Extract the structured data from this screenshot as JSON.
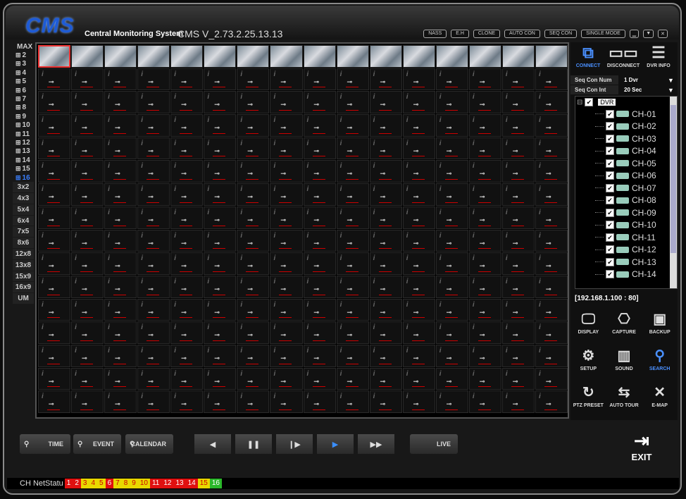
{
  "window": {
    "logo": "CMS",
    "title": "Central Monitoring System",
    "version": "CMS V_2.73.2.25.13.13",
    "buttons": [
      "NASS",
      "E.H",
      "CLONE",
      "AUTO CON",
      "SEQ CON",
      "SINGLE MODE"
    ],
    "window_controls": [
      "minimize-icon",
      "menu-icon",
      "close-icon"
    ]
  },
  "layout_menu": {
    "numbered": [
      "MAX",
      "2",
      "3",
      "4",
      "5",
      "6",
      "7",
      "8",
      "9",
      "10",
      "11",
      "12",
      "13",
      "14",
      "15",
      "16"
    ],
    "active": "16",
    "presets": [
      "3x2",
      "4x3",
      "5x4",
      "6x4",
      "7x5",
      "8x6",
      "12x8",
      "13x8",
      "15x9",
      "16x9",
      "UM"
    ]
  },
  "video_grid": {
    "columns": 16,
    "rows": 16,
    "live_rows": 1,
    "selected_cell": 0,
    "placeholder_icon": "disconnected-plug-icon",
    "placeholder_logo": "i"
  },
  "connection": {
    "buttons": [
      {
        "label": "CONNECT",
        "icon": "connect-icon",
        "active": true
      },
      {
        "label": "DISCONNECT",
        "icon": "disconnect-icon",
        "active": false
      },
      {
        "label": "DVR INFO",
        "icon": "dvr-info-icon",
        "active": false
      }
    ],
    "seq_con_num_label": "Seq Con Num",
    "seq_con_num_value": "1 Dvr",
    "seq_con_int_label": "Seq Con Int",
    "seq_con_int_value": "20 Sec"
  },
  "tree": {
    "root_label": "DVR",
    "channels": [
      "CH-01",
      "CH-02",
      "CH-03",
      "CH-04",
      "CH-05",
      "CH-06",
      "CH-07",
      "CH-08",
      "CH-09",
      "CH-10",
      "CH-11",
      "CH-12",
      "CH-13",
      "CH-14"
    ]
  },
  "ip_address": "[192.168.1.100 : 80]",
  "tools": [
    {
      "label": "DISPLAY",
      "icon": "display-icon",
      "active": false
    },
    {
      "label": "CAPTURE",
      "icon": "camera-icon",
      "active": false
    },
    {
      "label": "BACKUP",
      "icon": "floppy-icon",
      "active": false
    },
    {
      "label": "SETUP",
      "icon": "gear-icon",
      "active": false
    },
    {
      "label": "SOUND",
      "icon": "equalizer-icon",
      "active": false
    },
    {
      "label": "SEARCH",
      "icon": "search-icon",
      "active": true
    },
    {
      "label": "PTZ PRESET",
      "icon": "refresh-icon",
      "active": false
    },
    {
      "label": "AUTO TOUR",
      "icon": "arrows-icon",
      "active": false
    },
    {
      "label": "E-MAP",
      "icon": "map-icon",
      "active": false
    }
  ],
  "playback": {
    "search_buttons": [
      "TIME",
      "EVENT",
      "CALENDAR"
    ],
    "controls": [
      {
        "name": "rewind",
        "glyph": "◀"
      },
      {
        "name": "pause",
        "glyph": "❚❚"
      },
      {
        "name": "step",
        "glyph": "❙▶"
      },
      {
        "name": "play",
        "glyph": "▶"
      },
      {
        "name": "fast-forward",
        "glyph": "▶▶"
      }
    ],
    "active_control": "play",
    "live_label": "LIVE",
    "exit_label": "EXIT"
  },
  "status": {
    "label": "CH NetStatu",
    "channels": [
      {
        "n": "1",
        "color": "#e01010"
      },
      {
        "n": "2",
        "color": "#e01010"
      },
      {
        "n": "3",
        "color": "#e8d800"
      },
      {
        "n": "4",
        "color": "#e8d800"
      },
      {
        "n": "5",
        "color": "#e8d800"
      },
      {
        "n": "6",
        "color": "#e01010"
      },
      {
        "n": "7",
        "color": "#e8d800"
      },
      {
        "n": "8",
        "color": "#e8d800"
      },
      {
        "n": "9",
        "color": "#e8d800"
      },
      {
        "n": "10",
        "color": "#e8d800"
      },
      {
        "n": "11",
        "color": "#e01010"
      },
      {
        "n": "12",
        "color": "#e01010"
      },
      {
        "n": "13",
        "color": "#e01010"
      },
      {
        "n": "14",
        "color": "#e01010"
      },
      {
        "n": "15",
        "color": "#e8d800"
      },
      {
        "n": "16",
        "color": "#2ab82a"
      }
    ]
  }
}
